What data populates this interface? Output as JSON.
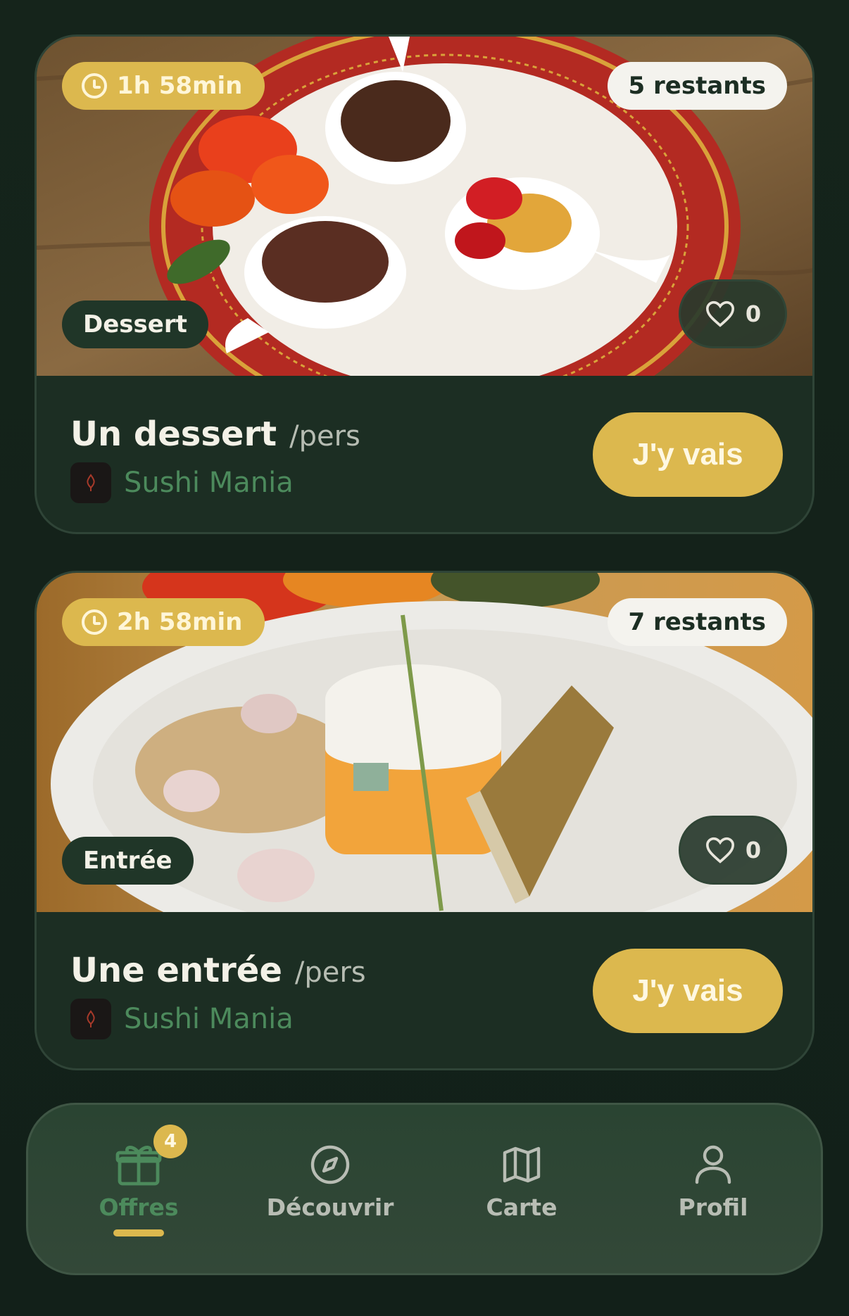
{
  "offers": [
    {
      "time_left": "1h 58min",
      "remaining": "5 restants",
      "category": "Dessert",
      "likes": "0",
      "title": "Un dessert",
      "unit": "/pers",
      "restaurant": "Sushi Mania",
      "cta": "J'y vais",
      "image": "dessert-trio-plate"
    },
    {
      "time_left": "2h 58min",
      "remaining": "7 restants",
      "category": "Entrée",
      "likes": "0",
      "title": "Une entrée",
      "unit": "/pers",
      "restaurant": "Sushi Mania",
      "cta": "J'y vais",
      "image": "starter-plate"
    }
  ],
  "nav": {
    "items": [
      {
        "label": "Offres",
        "icon": "gift-icon",
        "badge": "4",
        "active": true
      },
      {
        "label": "Découvrir",
        "icon": "compass-icon",
        "active": false
      },
      {
        "label": "Carte",
        "icon": "map-icon",
        "active": false
      },
      {
        "label": "Profil",
        "icon": "user-icon",
        "active": false
      }
    ]
  },
  "colors": {
    "background": "#14231a",
    "card": "#1c2e23",
    "accent_gold": "#dcb84e",
    "accent_green": "#4c8a5c"
  }
}
